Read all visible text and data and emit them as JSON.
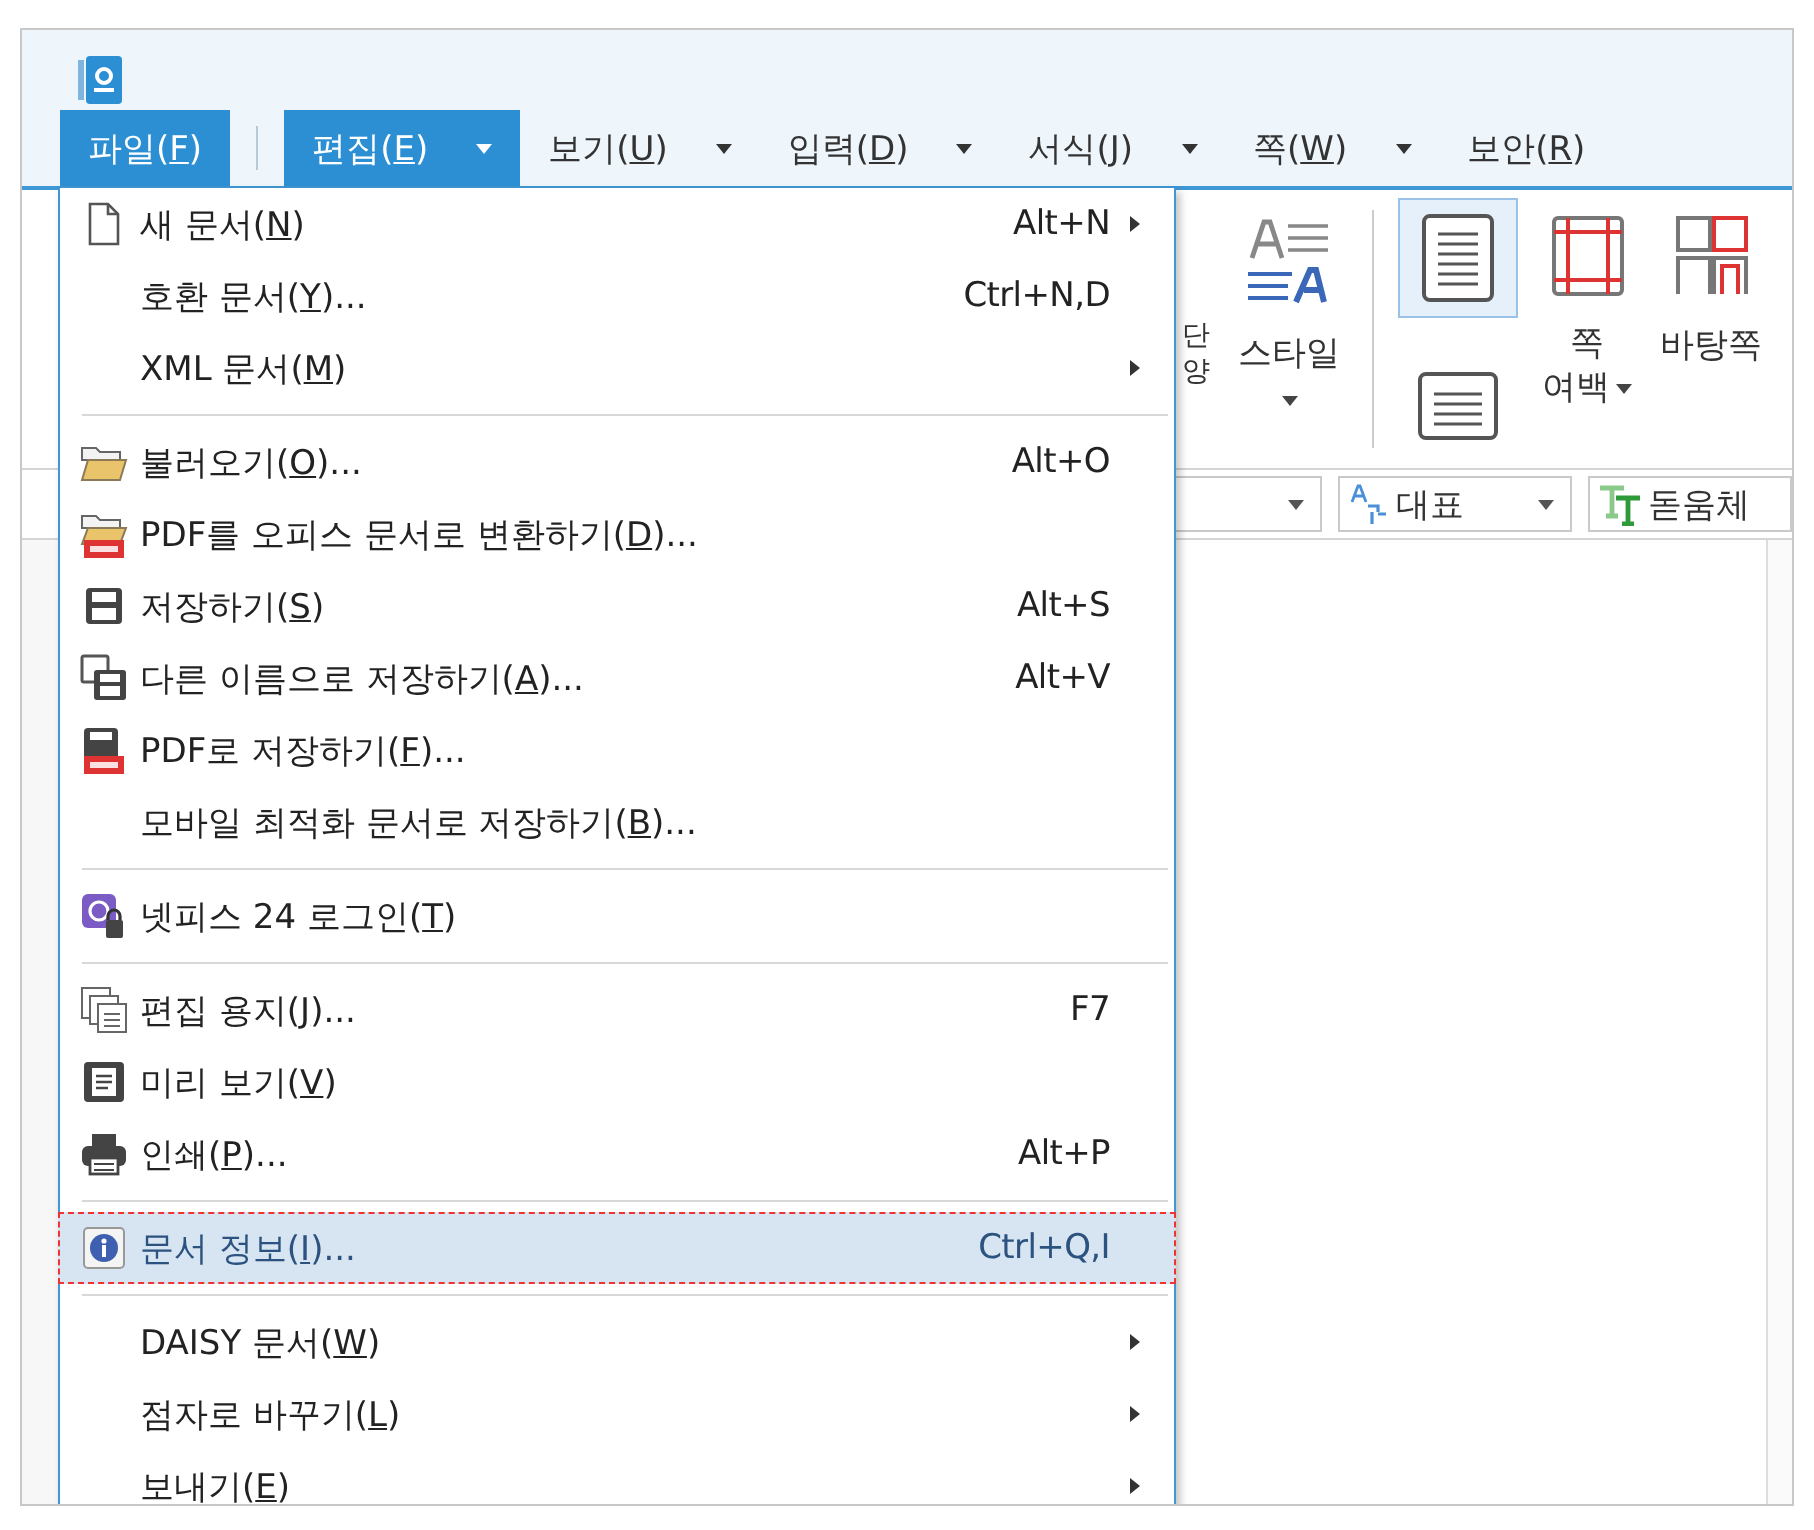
{
  "menu_bar": {
    "tabs": [
      {
        "label": "파일(F)",
        "selected": true,
        "dropdown": false
      },
      {
        "label": "편집(E)",
        "selected": true,
        "dropdown": true
      },
      {
        "label": "보기(U)",
        "selected": false,
        "dropdown": true
      },
      {
        "label": "입력(D)",
        "selected": false,
        "dropdown": true
      },
      {
        "label": "서식(J)",
        "selected": false,
        "dropdown": true
      },
      {
        "label": "쪽(W)",
        "selected": false,
        "dropdown": true
      },
      {
        "label": "보안(R)",
        "selected": false,
        "dropdown": false
      }
    ]
  },
  "ribbon": {
    "clipped_label": [
      "단",
      "양"
    ],
    "style_button": {
      "label": "스타일"
    },
    "page_views": [
      {
        "selected": true
      },
      {
        "selected": false
      }
    ],
    "margin_button": {
      "label_lines": [
        "쪽",
        "여백"
      ]
    },
    "master_button": {
      "label": "바탕쪽"
    }
  },
  "toolbar": {
    "style_box": {
      "value": "대표"
    },
    "font_box": {
      "value": "돋움체"
    }
  },
  "file_menu": {
    "groups": [
      [
        {
          "kind": "new",
          "label": "새 문서(N)",
          "shortcut": "Alt+N",
          "submenu": true,
          "selected": false
        },
        {
          "kind": "plain",
          "label": "호환 문서(Y)...",
          "shortcut": "Ctrl+N,D",
          "submenu": false,
          "selected": false
        },
        {
          "kind": "plain",
          "label": "XML 문서(M)",
          "submenu": true,
          "selected": false
        }
      ],
      [
        {
          "kind": "open",
          "label": "불러오기(O)...",
          "shortcut": "Alt+O",
          "submenu": false,
          "selected": false
        },
        {
          "kind": "pdf-open",
          "label": "PDF를 오피스 문서로 변환하기(D)...",
          "submenu": false,
          "selected": false
        },
        {
          "kind": "save",
          "label": "저장하기(S)",
          "shortcut": "Alt+S",
          "submenu": false,
          "selected": false
        },
        {
          "kind": "save-as",
          "label": "다른 이름으로 저장하기(A)...",
          "shortcut": "Alt+V",
          "submenu": false,
          "selected": false
        },
        {
          "kind": "pdf-save",
          "label": "PDF로 저장하기(F)...",
          "submenu": false,
          "selected": false
        },
        {
          "kind": "plain",
          "label": "모바일 최적화 문서로 저장하기(B)...",
          "submenu": false,
          "selected": false
        }
      ],
      [
        {
          "kind": "login",
          "label": "넷피스 24 로그인(T)",
          "submenu": false,
          "selected": false
        }
      ],
      [
        {
          "kind": "paper",
          "label": "편집 용지(J)...",
          "shortcut": "F7",
          "submenu": false,
          "selected": false
        },
        {
          "kind": "preview",
          "label": "미리 보기(V)",
          "submenu": false,
          "selected": false
        },
        {
          "kind": "print",
          "label": "인쇄(P)...",
          "shortcut": "Alt+P",
          "submenu": false,
          "selected": false
        }
      ],
      [
        {
          "kind": "info",
          "label": "문서 정보(I)...",
          "shortcut": "Ctrl+Q,I",
          "submenu": false,
          "selected": true
        }
      ],
      [
        {
          "kind": "plain",
          "label": "DAISY 문서(W)",
          "submenu": true,
          "selected": false
        },
        {
          "kind": "plain",
          "label": "점자로 바꾸기(L)",
          "submenu": true,
          "selected": false
        },
        {
          "kind": "plain",
          "label": "보내기(E)",
          "submenu": true,
          "selected": false
        }
      ]
    ]
  }
}
